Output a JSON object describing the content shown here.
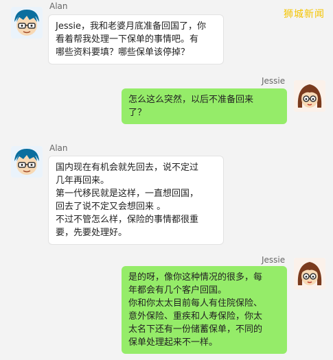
{
  "watermark": "狮城新闻",
  "messages": [
    {
      "sender": "Alan",
      "side": "left",
      "lines": [
        "Jessie，我和老婆月底准备回国了，你",
        "看着帮我处理一下保单的事情吧。有",
        "哪些资料要填？哪些保单该停掉？"
      ]
    },
    {
      "sender": "Jessie",
      "side": "right",
      "lines": [
        "怎么这么突然，以后不准备回来",
        "了？"
      ]
    },
    {
      "sender": "Alan",
      "side": "left",
      "lines": [
        "国内现在有机会就先回去，说不定过",
        "几年再回来。",
        "第一代移民就是这样，一直想回国，",
        "回去了说不定又会想回来 。",
        "不过不管怎么样，保险的事情都很重",
        "要，先要处理好。"
      ]
    },
    {
      "sender": "Jessie",
      "side": "right",
      "lines": [
        "是的呀，像你这种情况的很多，每",
        "年都会有几个客户回国。",
        "你和你太太目前每人有住院保险、",
        "意外保险、重疾和人寿保险，你太",
        "太名下还有一份储蓄保单，不同的",
        "保单处理起来不一样。"
      ]
    }
  ]
}
